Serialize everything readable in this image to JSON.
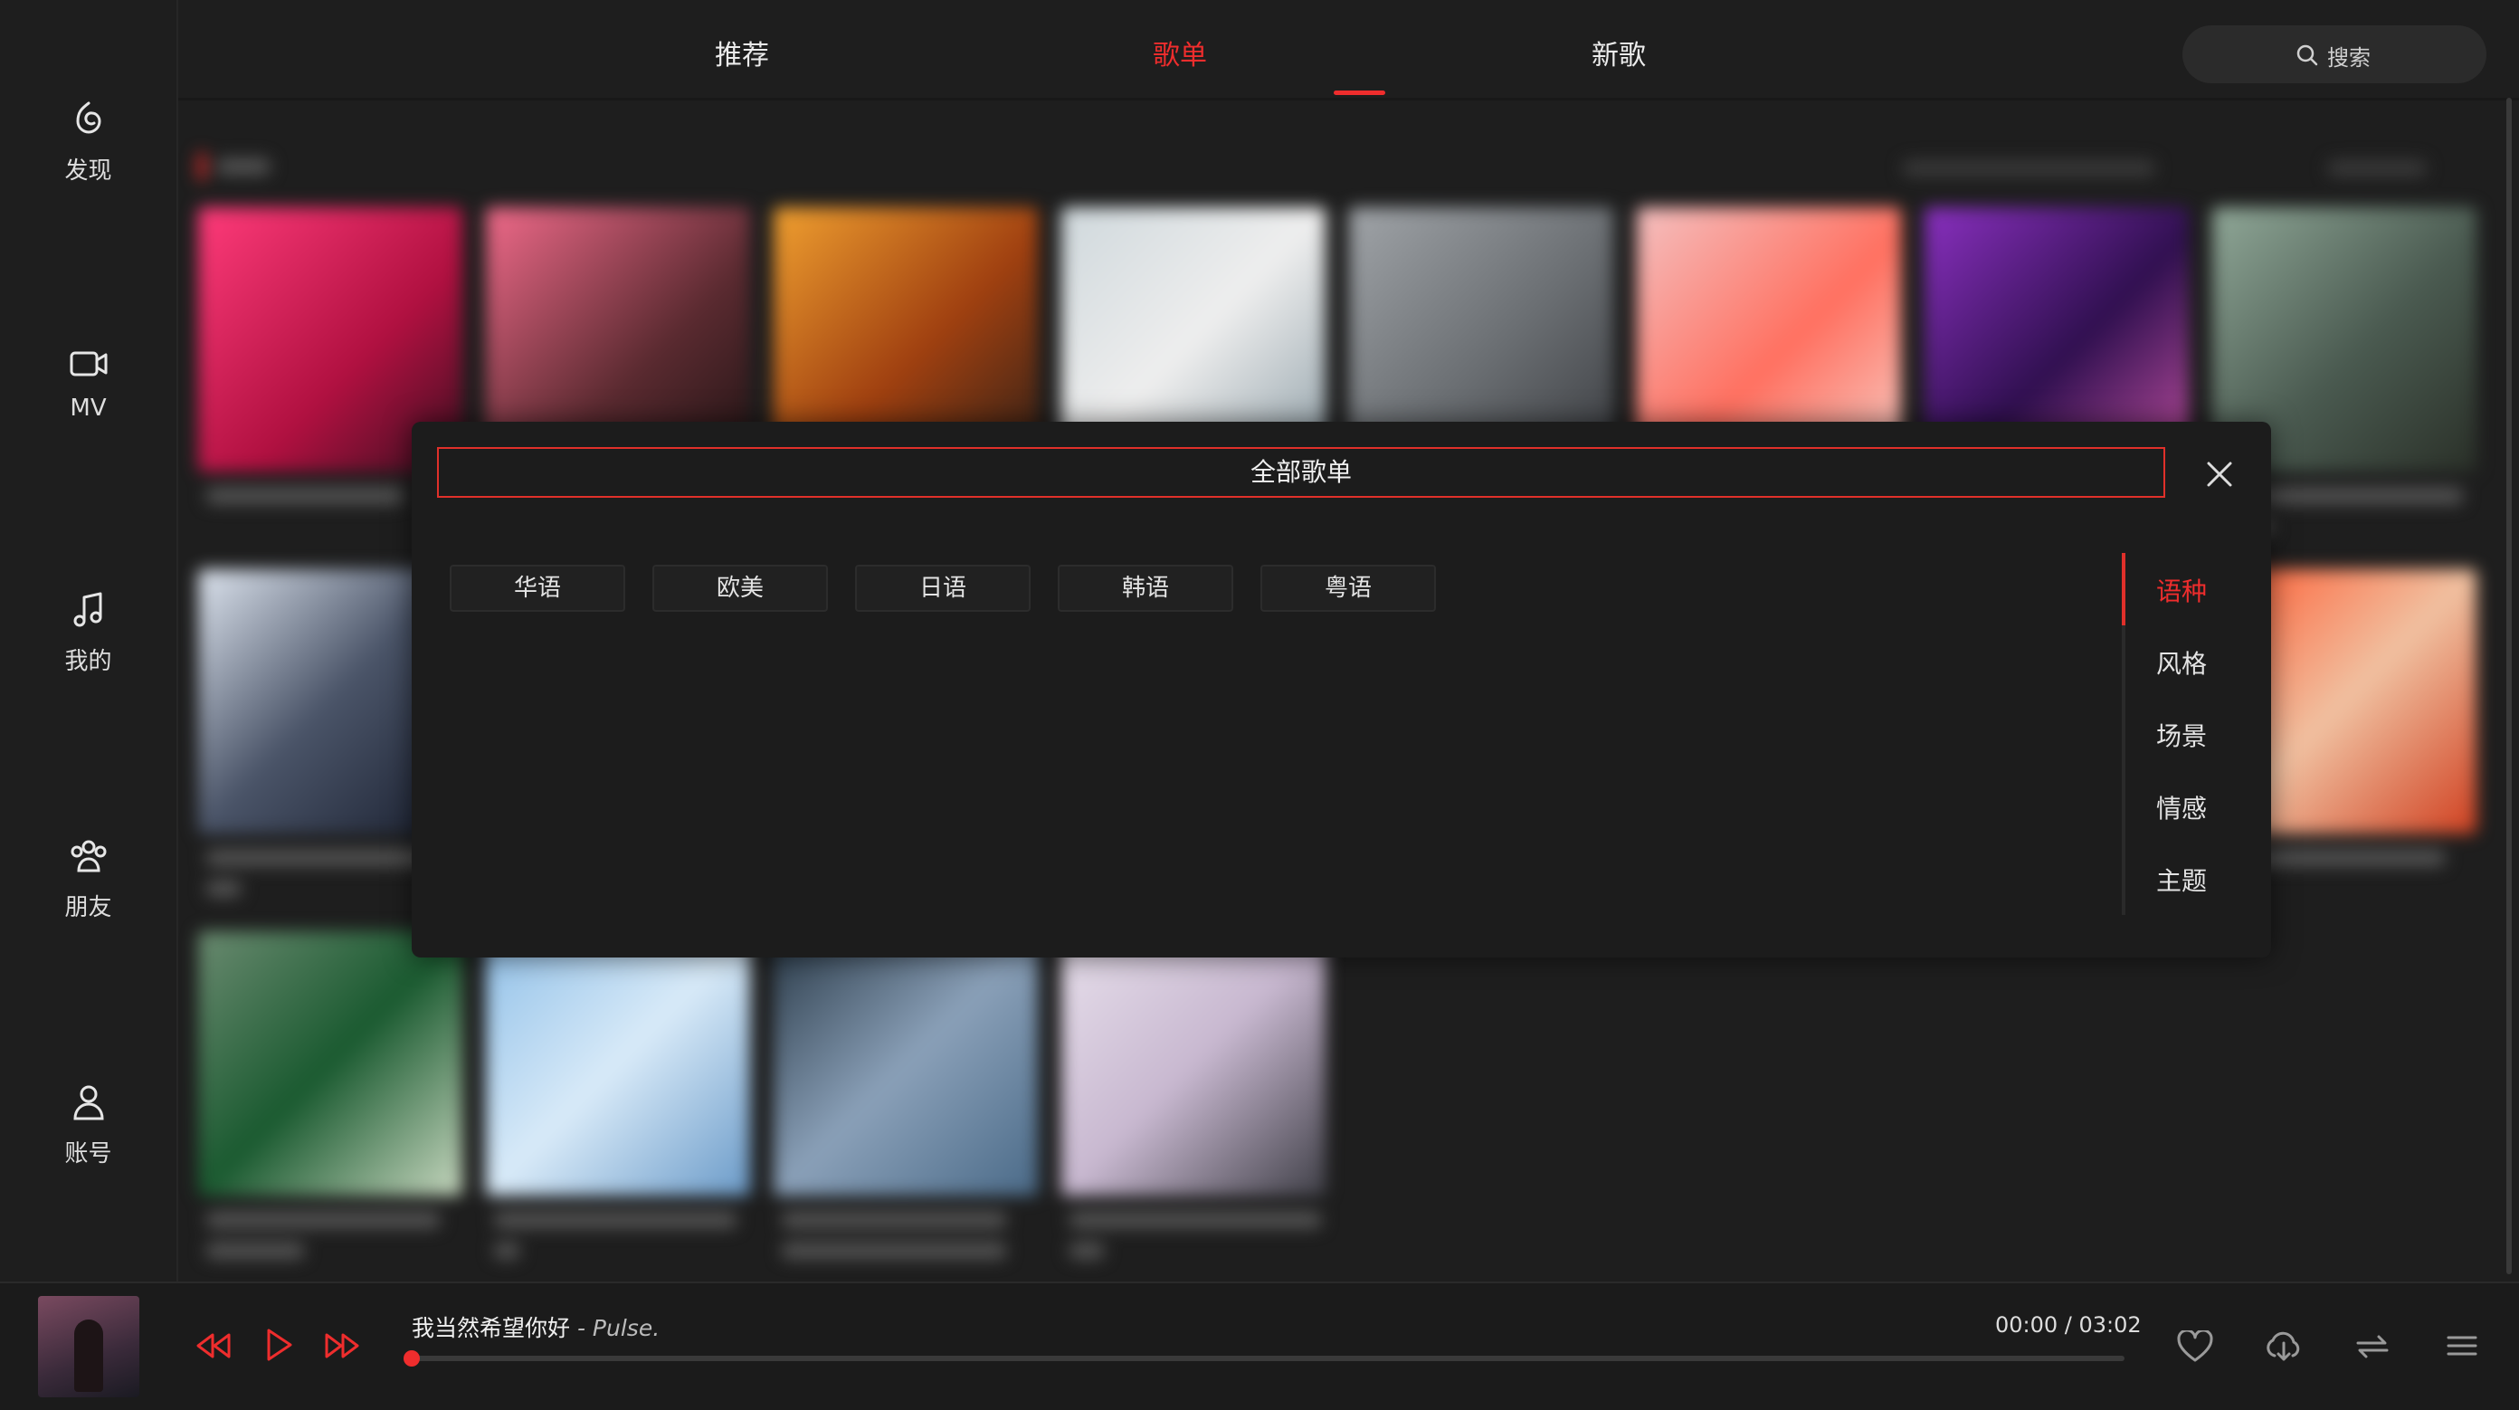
{
  "sidebar": {
    "items": [
      {
        "label": "发现",
        "icon": "discover-icon"
      },
      {
        "label": "MV",
        "icon": "video-icon"
      },
      {
        "label": "我的",
        "icon": "music-note-icon"
      },
      {
        "label": "朋友",
        "icon": "friends-icon"
      },
      {
        "label": "账号",
        "icon": "user-icon"
      }
    ]
  },
  "header": {
    "tabs": [
      {
        "label": "推荐",
        "active": false
      },
      {
        "label": "歌单",
        "active": true
      },
      {
        "label": "新歌",
        "active": false
      }
    ],
    "search_label": "搜索"
  },
  "modal": {
    "title": "全部歌单",
    "chips": [
      "华语",
      "欧美",
      "日语",
      "韩语",
      "粤语"
    ],
    "categories": [
      {
        "label": "语种",
        "active": true
      },
      {
        "label": "风格",
        "active": false
      },
      {
        "label": "场景",
        "active": false
      },
      {
        "label": "情感",
        "active": false
      },
      {
        "label": "主题",
        "active": false
      }
    ]
  },
  "player": {
    "song_title": "我当然希望你好",
    "artist": " - Pulse.",
    "current_time": "00:00",
    "separator": " / ",
    "duration": "03:02",
    "progress": 0
  },
  "colors": {
    "accent": "#ef2d2d",
    "background": "#1e1e1e",
    "modal_bg": "#1c1c1c"
  }
}
